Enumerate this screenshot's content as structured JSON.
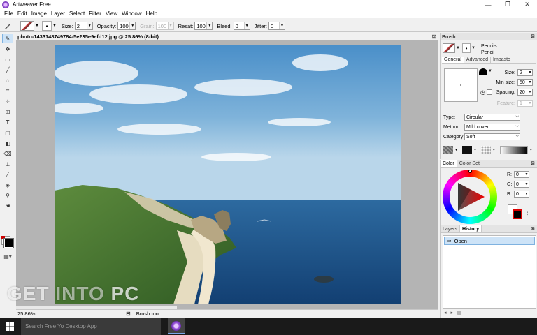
{
  "window": {
    "title": "Artweaver Free",
    "minimize": "—",
    "maximize": "❐",
    "close": "✕"
  },
  "menu": [
    "File",
    "Edit",
    "Image",
    "Layer",
    "Select",
    "Filter",
    "View",
    "Window",
    "Help"
  ],
  "options": {
    "size_label": "Size:",
    "size_value": "2",
    "opacity_label": "Opacity:",
    "opacity_value": "100",
    "grain_label": "Grain:",
    "grain_value": "100",
    "resat_label": "Resat:",
    "resat_value": "100",
    "bleed_label": "Bleed:",
    "bleed_value": "0",
    "jitter_label": "Jitter:",
    "jitter_value": "0"
  },
  "document": {
    "tab_title": "photo-1433148749784-5e235e9efd12.jpg @ 25.86% (8-bit)",
    "zoom": "25.86%",
    "tool": "Brush tool"
  },
  "brush_panel": {
    "title": "Brush",
    "category": "Pencils",
    "variant": "Pencil",
    "tabs": [
      "General",
      "Advanced",
      "Impasto"
    ],
    "size_label": "Size:",
    "size_value": "2",
    "min_size_label": "Min size:",
    "min_size_value": "50",
    "spacing_label": "Spacing:",
    "spacing_value": "20",
    "feature_label": "Feature:",
    "feature_value": "1",
    "type_label": "Type:",
    "type_value": "Circular",
    "method_label": "Method:",
    "method_value": "Mild cover",
    "category_label": "Category:",
    "category_value": "Soft"
  },
  "color_panel": {
    "tabs": [
      "Color",
      "Color Set"
    ],
    "r_label": "R:",
    "r_value": "0",
    "g_label": "G:",
    "g_value": "0",
    "b_label": "B:",
    "b_value": "0"
  },
  "layers_panel": {
    "tabs": [
      "Layers",
      "History"
    ],
    "history_items": [
      "Open"
    ]
  },
  "taskbar": {
    "search_placeholder": "Search Free Yo Desktop App"
  },
  "watermark": {
    "part1": "GET ",
    "part2": "INTO",
    "part3": " PC"
  },
  "colors": {
    "accent": "#7fb2e0",
    "canvas_bg": "#b4b4b4",
    "foreground": "#000000",
    "background": "#ffffff"
  }
}
